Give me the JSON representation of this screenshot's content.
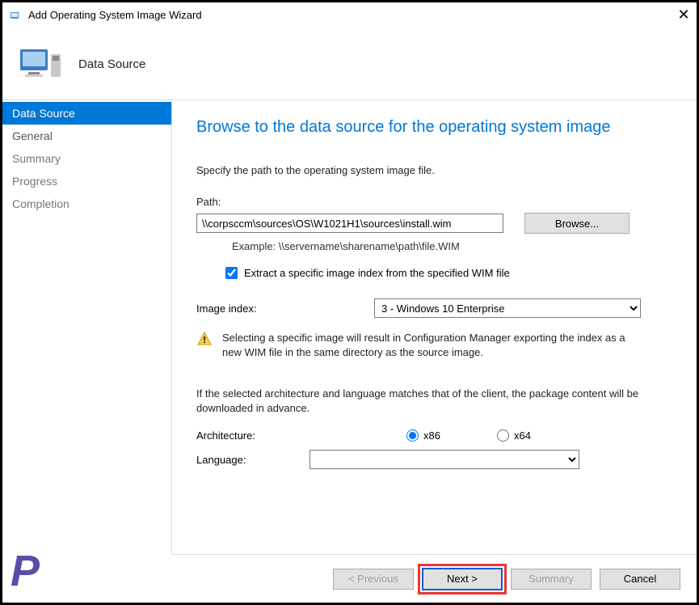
{
  "window": {
    "title": "Add Operating System Image Wizard"
  },
  "header": {
    "label": "Data Source"
  },
  "sidebar": {
    "items": [
      {
        "label": "Data Source",
        "active": true
      },
      {
        "label": "General"
      },
      {
        "label": "Summary"
      },
      {
        "label": "Progress"
      },
      {
        "label": "Completion"
      }
    ]
  },
  "page": {
    "heading": "Browse to the data source for the operating system image",
    "instruction": "Specify the path to the operating system image file.",
    "path_label": "Path:",
    "path_value": "\\\\corpsccm\\sources\\OS\\W1021H1\\sources\\install.wim",
    "browse_label": "Browse...",
    "example": "Example: \\\\servername\\sharename\\path\\file.WIM",
    "extract_checkbox": "Extract a specific image index from the specified WIM file",
    "extract_checked": true,
    "image_index_label": "Image index:",
    "image_index_value": "3 - Windows 10 Enterprise",
    "image_index_options": [
      "3 - Windows 10 Enterprise"
    ],
    "warning": "Selecting a specific image will result in Configuration Manager exporting the index as a new WIM file in the same directory as the source image.",
    "prefetch": "If the selected architecture and language matches that of the client, the package content will be downloaded in advance.",
    "architecture_label": "Architecture:",
    "architecture_options": {
      "x86": "x86",
      "x64": "x64"
    },
    "architecture_selected": "x86",
    "language_label": "Language:",
    "language_value": ""
  },
  "footer": {
    "previous": "< Previous",
    "next": "Next >",
    "summary": "Summary",
    "cancel": "Cancel"
  }
}
